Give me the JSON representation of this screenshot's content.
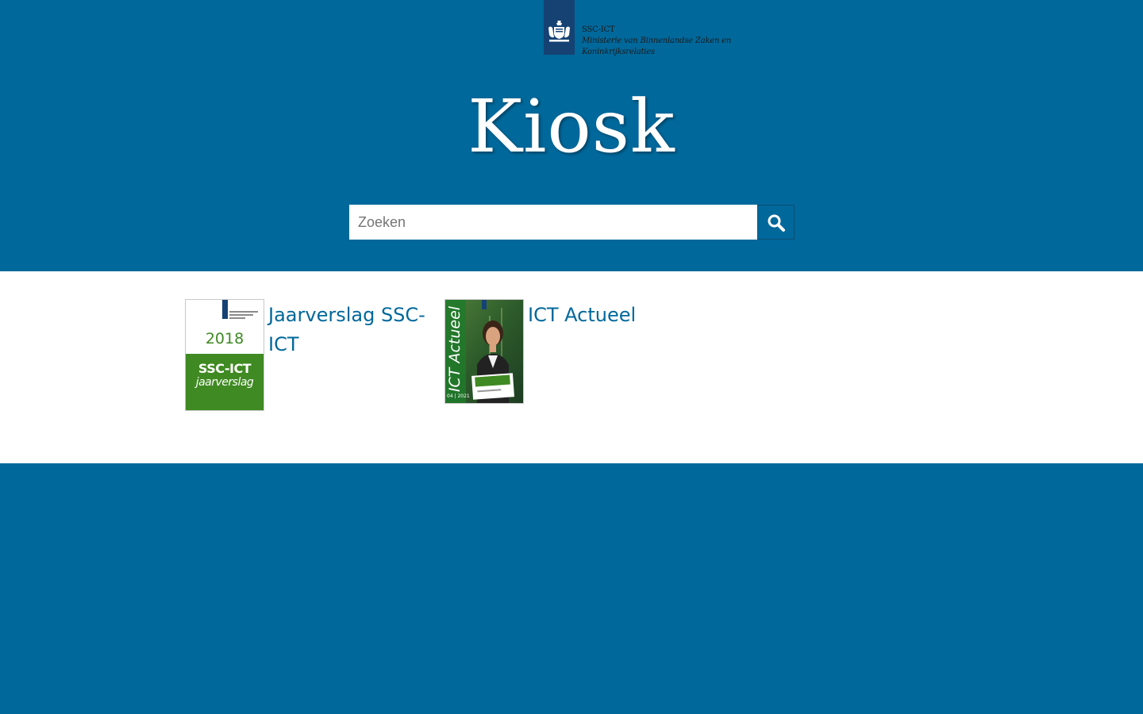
{
  "logo": {
    "line1": "SSC-ICT",
    "line2": "Ministerie van Binnenlandse Zaken en",
    "line3": "Koninkrijksrelaties",
    "icon": "royal-coat-of-arms-icon"
  },
  "title": "Kiosk",
  "search": {
    "placeholder": "Zoeken",
    "value": "",
    "button_icon": "search-icon"
  },
  "publications": [
    {
      "label": "Jaarverslag SSC-ICT",
      "cover": {
        "year": "2018",
        "line1": "SSC-ICT",
        "line2": "jaarverslag"
      }
    },
    {
      "label": "ICT Actueel",
      "cover": {
        "masthead": "ICT Actueel",
        "issue": "04 | 2021"
      }
    }
  ],
  "colors": {
    "brand_blue": "#01689b",
    "emblem_blue": "#154273",
    "cover_green": "#3f8a22",
    "white": "#ffffff"
  }
}
